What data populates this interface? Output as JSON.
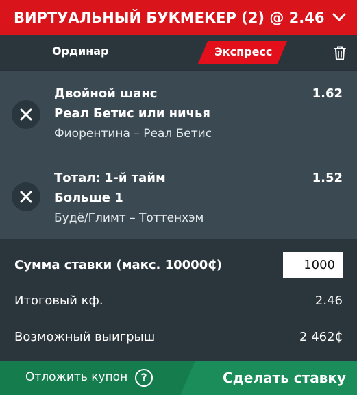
{
  "header": {
    "title": "ВИРТУАЛЬНЫЙ БУКМЕКЕР (2) @ 2.46",
    "collapse_icon": "chevron-down-icon"
  },
  "tabs": {
    "single": "Ординар",
    "express": "Экспресс",
    "active": "express",
    "clear_icon": "trash-icon"
  },
  "bets": [
    {
      "market": "Двойной шанс",
      "selection": "Реал Бетис или ничья",
      "event": "Фиорентина – Реал Бетис",
      "odds": "1.62",
      "remove_icon": "close-icon"
    },
    {
      "market": "Тотал: 1-й тайм",
      "selection": "Больше 1",
      "event": "Будё/Глимт – Тоттенхэм",
      "odds": "1.52",
      "remove_icon": "close-icon"
    }
  ],
  "summary": {
    "stake_label": "Сумма ставки (макс. 10000₵)",
    "stake_value": "1000",
    "total_odds_label": "Итоговый кф.",
    "total_odds_value": "2.46",
    "potential_win_label": "Возможный выигрыш",
    "potential_win_value": "2 462₵"
  },
  "footer": {
    "postpone_label": "Отложить купон",
    "help_icon": "question-circle-icon",
    "help_glyph": "?",
    "place_bet_label": "Сделать ставку"
  },
  "colors": {
    "header_red": "#d9141b",
    "accent_red": "#e3101b",
    "green_dark": "#157c4e",
    "green_light": "#1b8d5a",
    "panel_dark": "#2b363c",
    "panel_mid": "#3b4a52"
  }
}
